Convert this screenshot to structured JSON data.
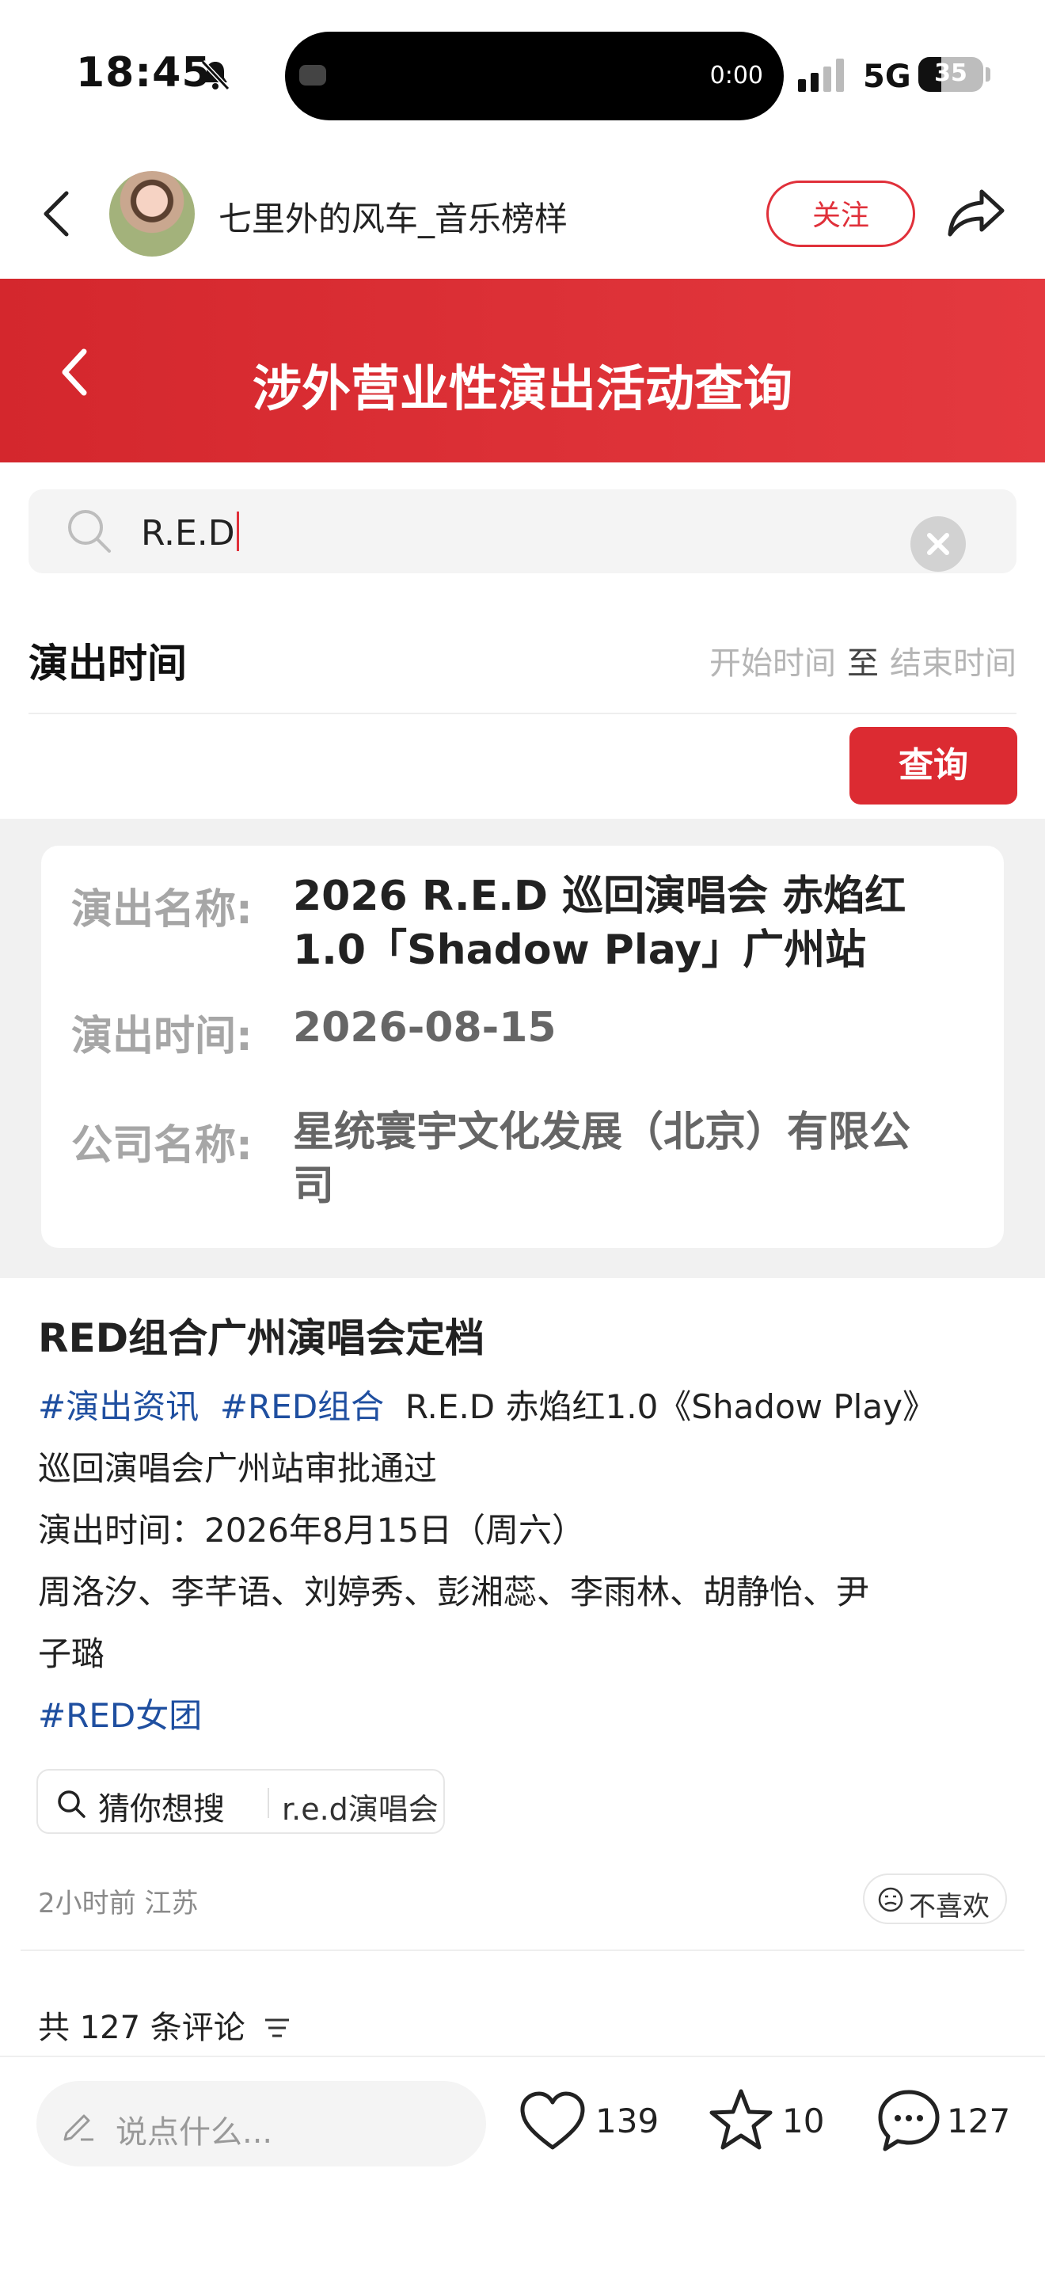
{
  "status_bar": {
    "time": "18:45",
    "island_timer": "0:00",
    "network": "5G",
    "battery": "35",
    "battery_level": 0.35
  },
  "header": {
    "author_name": "七里外的风车_音乐榜样",
    "follow_label": "关注"
  },
  "banner": {
    "title": "涉外营业性演出活动查询"
  },
  "search": {
    "value": "R.E.D"
  },
  "date_filter": {
    "label": "演出时间",
    "start_placeholder": "开始时间",
    "separator": "至",
    "end_placeholder": "结束时间"
  },
  "query_button": "查询",
  "result": {
    "name_label": "演出名称:",
    "name_line1": "2026 R.E.D 巡回演唱会 赤焰红",
    "name_line2": "1.0「Shadow Play」广州站",
    "date_label": "演出时间:",
    "date_value": "2026-08-15",
    "company_label": "公司名称:",
    "company_line1": "星统寰宇文化发展（北京）有限公",
    "company_line2": "司"
  },
  "post": {
    "title": "RED组合广州演唱会定档",
    "tag1": "#演出资讯",
    "tag2": "#RED组合",
    "line1_text": "R.E.D 赤焰红1.0《Shadow Play》",
    "line2": "巡回演唱会广州站审批通过",
    "line3": "演出时间：2026年8月15日（周六）",
    "line4": "周洛汐、李芊语、刘婷秀、彭湘蕊、李雨林、胡静怡、尹",
    "line5": "子璐",
    "tag3": "#RED女团",
    "suggest_prefix": "猜你想搜",
    "suggest_query": "r.e.d演唱会",
    "meta": "2小时前 江苏",
    "dislike": "不喜欢"
  },
  "comments": {
    "header": "共 127 条评论"
  },
  "bottom_bar": {
    "input_placeholder": "说点什么...",
    "likes": "139",
    "favorites": "10",
    "comments": "127"
  },
  "colors": {
    "brand_red": "#dc2b32",
    "tag_blue": "#1f4fa0"
  },
  "icons": [
    "notification-off-icon",
    "signal-icon",
    "back-icon",
    "share-icon",
    "search-icon",
    "clear-icon",
    "filter-icon",
    "pencil-icon",
    "heart-icon",
    "star-icon",
    "comment-icon",
    "dislike-face-icon"
  ]
}
